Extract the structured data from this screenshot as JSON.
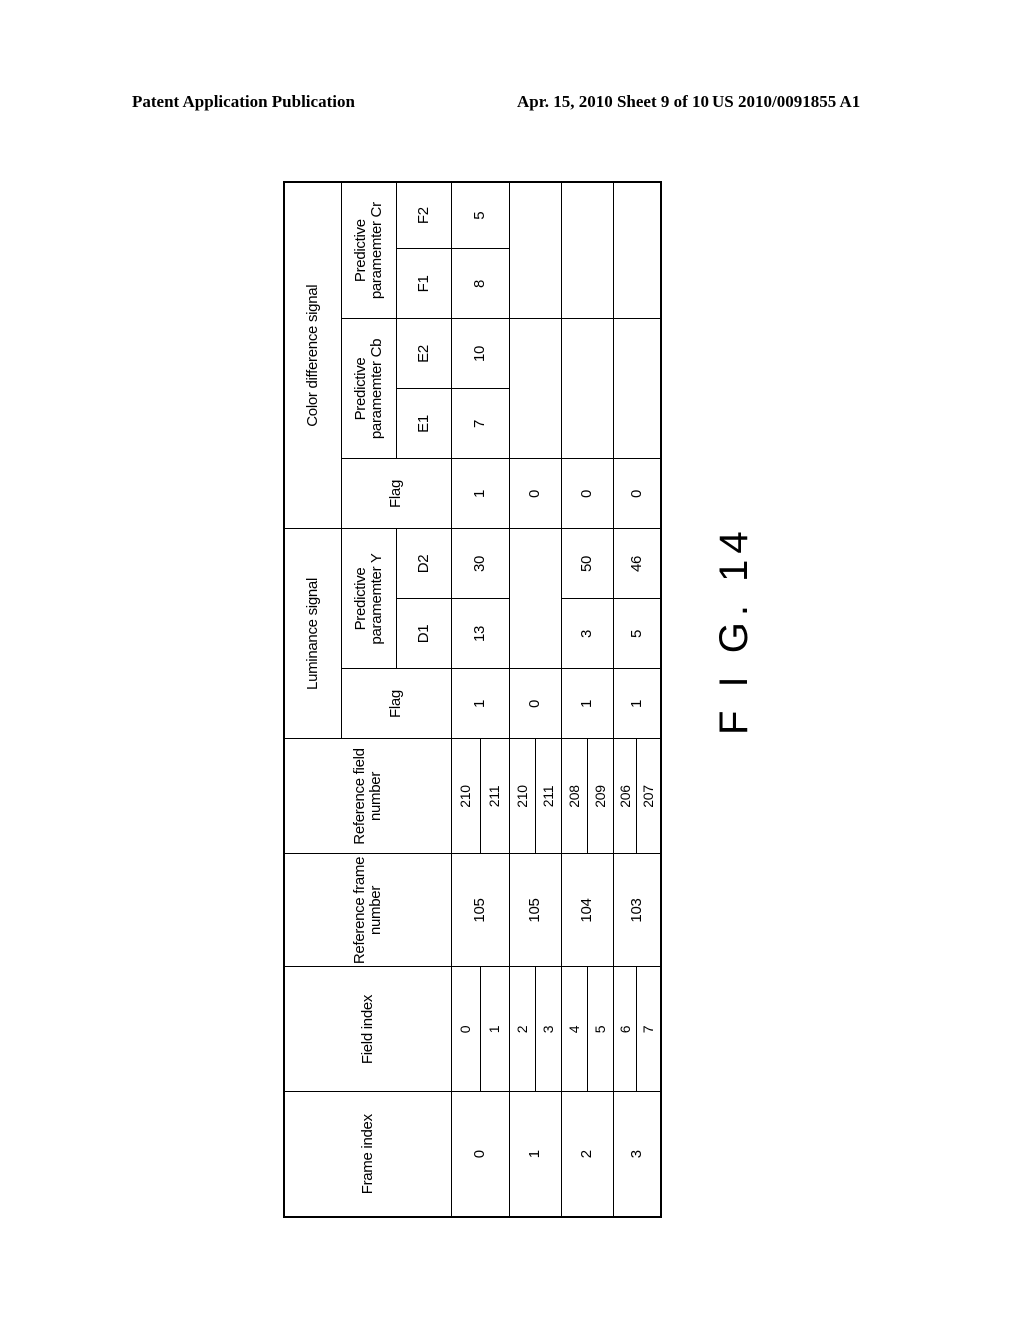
{
  "page_header": {
    "left": "Patent Application Publication",
    "middle": "Apr. 15, 2010  Sheet 9 of 10",
    "right": "US 2010/0091855 A1"
  },
  "figure_label": "F I G. 14",
  "table": {
    "headers": {
      "frame_index": "Frame index",
      "field_index": "Field index",
      "ref_frame": "Reference frame number",
      "ref_field": "Reference field number",
      "luminance": "Luminance signal",
      "color_diff": "Color difference signal",
      "flag": "Flag",
      "param_y": "Predictive paramemter  Y",
      "param_cb": "Predictive paramemter  Cb",
      "param_cr": "Predictive paramemter  Cr",
      "d1": "D1",
      "d2": "D2",
      "e1": "E1",
      "e2": "E2",
      "f1": "F1",
      "f2": "F2"
    },
    "rows": [
      {
        "frame": "0",
        "fields": [
          "0",
          "1"
        ],
        "ref_frame": "105",
        "ref_fields": [
          "210",
          "211"
        ],
        "lum_flag": "1",
        "d1": "13",
        "d2": "30",
        "c_flag": "1",
        "e1": "7",
        "e2": "10",
        "f1": "8",
        "f2": "5"
      },
      {
        "frame": "1",
        "fields": [
          "2",
          "3"
        ],
        "ref_frame": "105",
        "ref_fields": [
          "210",
          "211"
        ],
        "lum_flag": "0",
        "d1": "",
        "d2": "",
        "c_flag": "0",
        "e1": "",
        "e2": "",
        "f1": "",
        "f2": ""
      },
      {
        "frame": "2",
        "fields": [
          "4",
          "5"
        ],
        "ref_frame": "104",
        "ref_fields": [
          "208",
          "209"
        ],
        "lum_flag": "1",
        "d1": "3",
        "d2": "50",
        "c_flag": "0",
        "e1": "",
        "e2": "",
        "f1": "",
        "f2": ""
      },
      {
        "frame": "3",
        "fields": [
          "6",
          "7"
        ],
        "ref_frame": "103",
        "ref_fields": [
          "206",
          "207"
        ],
        "lum_flag": "1",
        "d1": "5",
        "d2": "46",
        "c_flag": "0",
        "e1": "",
        "e2": "",
        "f1": "",
        "f2": ""
      }
    ]
  }
}
